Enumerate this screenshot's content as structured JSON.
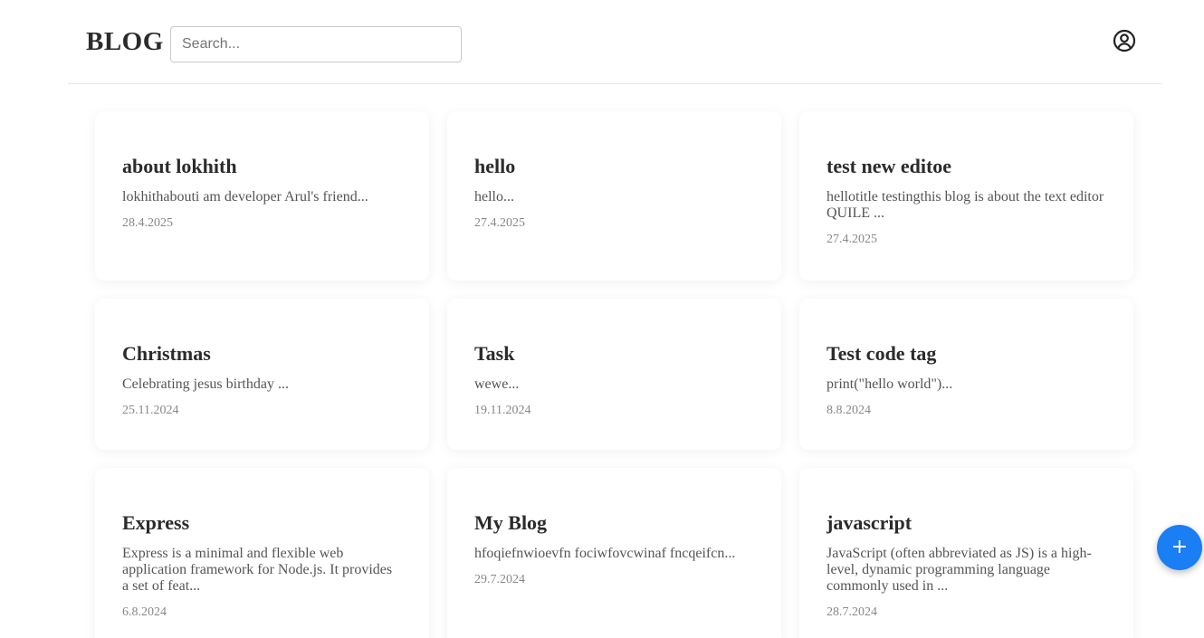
{
  "header": {
    "logo": "BLOG",
    "search_placeholder": "Search...",
    "account_icon": "user-circle-icon"
  },
  "posts": [
    {
      "title": "about lokhith",
      "excerpt": "lokhithabouti am developer Arul's friend...",
      "date": "28.4.2025"
    },
    {
      "title": "hello",
      "excerpt": "hello...",
      "date": "27.4.2025"
    },
    {
      "title": "test new editoe",
      "excerpt": "hellotitle testingthis blog is about the text editor QUILE ...",
      "date": "27.4.2025"
    },
    {
      "title": "Christmas",
      "excerpt": "Celebrating jesus birthday ...",
      "date": "25.11.2024"
    },
    {
      "title": "Task",
      "excerpt": "wewe...",
      "date": "19.11.2024"
    },
    {
      "title": "Test code tag",
      "excerpt": "print(\"hello world\")...",
      "date": "8.8.2024"
    },
    {
      "title": "Express",
      "excerpt": "Express is a minimal and flexible web application framework for Node.js. It provides a set of feat...",
      "date": "6.8.2024"
    },
    {
      "title": "My Blog",
      "excerpt": "hfoqiefnwioevfn fociwfovcwinaf fncqeifcn...",
      "date": "29.7.2024"
    },
    {
      "title": "javascript",
      "excerpt": "JavaScript (often abbreviated as JS) is a high-level, dynamic programming language commonly used in ...",
      "date": "28.7.2024"
    }
  ],
  "fab": {
    "label": "+",
    "icon": "plus-icon",
    "color": "#1a7ef5"
  }
}
